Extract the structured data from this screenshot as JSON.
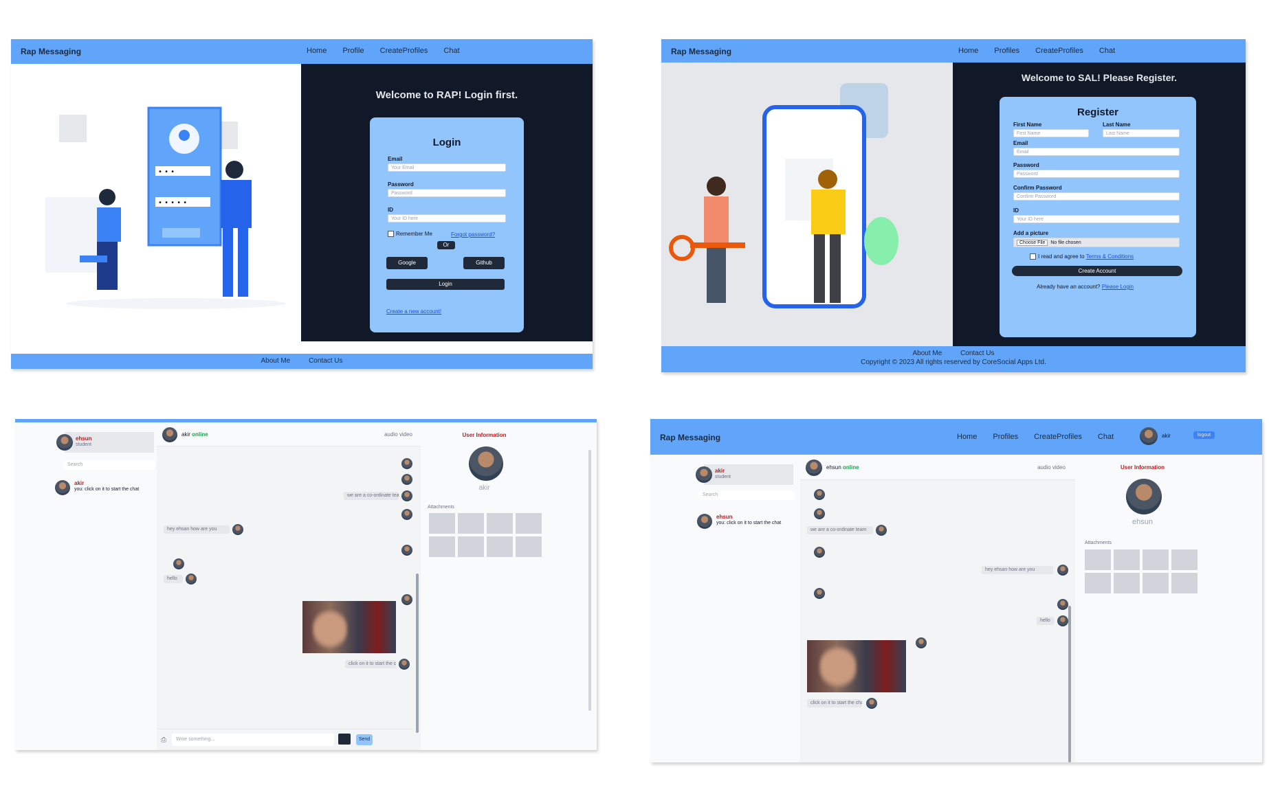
{
  "login": {
    "brand": "Rap Messaging",
    "nav": [
      "Home",
      "Profile",
      "CreateProfiles",
      "Chat"
    ],
    "welcome": "Welcome to RAP! Login first.",
    "card_title": "Login",
    "email_label": "Email",
    "email_placeholder": "Your Email",
    "password_label": "Password",
    "password_placeholder": "Password",
    "id_label": "ID",
    "id_placeholder": "Your ID here",
    "remember_label": "Remember Me",
    "forgot_link": "Forgot password?",
    "or_label": "Or",
    "google_button": "Google",
    "github_button": "Github",
    "login_button": "Login",
    "create_link": "Create a new account!",
    "footer_links": [
      "About Me",
      "Contact Us"
    ]
  },
  "register": {
    "brand": "Rap Messaging",
    "nav": [
      "Home",
      "Profiles",
      "CreateProfiles",
      "Chat"
    ],
    "welcome": "Welcome to SAL! Please Register.",
    "card_title": "Register",
    "first_name_label": "First Name",
    "first_name_placeholder": "First Name",
    "last_name_label": "Last Name",
    "last_name_placeholder": "Last Name",
    "email_label": "Email",
    "email_placeholder": "Email",
    "password_label": "Password",
    "password_placeholder": "Password",
    "confirm_label": "Confirm Password",
    "confirm_placeholder": "Confirm Password",
    "id_label": "ID",
    "id_placeholder": "Your ID here",
    "picture_label": "Add a picture",
    "choose_file": "Choose File",
    "no_file": "No file chosen",
    "terms_prefix": "I read and agree to",
    "terms_link": "Terms & Conditions",
    "create_button": "Create Account",
    "have_account": "Already have an account?",
    "login_link": "Please Login",
    "footer_links": [
      "About Me",
      "Contact Us"
    ],
    "copyright": "Copyright © 2023 All rights reserved by CoreSocial Apps Ltd."
  },
  "chat1": {
    "me_name": "ehsun",
    "me_status": "student",
    "search_placeholder": "Search",
    "contact_name": "akir",
    "contact_preview": "you: click on it to start the chat",
    "header_name": "akir",
    "header_status": "online",
    "header_actions": "audio video",
    "info_title": "User Information",
    "info_name": "akir",
    "attachments_label": "Attachments",
    "messages": [
      "we are a co-ordinate team",
      "hey ehsan how are you",
      "hello",
      "click on it to start the chat"
    ],
    "input_placeholder": "Write something...",
    "send_button": "Send"
  },
  "chat2": {
    "brand": "Rap Messaging",
    "nav": [
      "Home",
      "Profiles",
      "CreateProfiles",
      "Chat"
    ],
    "user_name": "akir",
    "logout": "logout",
    "me_name": "akir",
    "me_status": "student",
    "search_placeholder": "Search",
    "contact_name": "ehsun",
    "contact_preview": "you: click on it to start the chat",
    "header_name": "ehsun",
    "header_status": "online",
    "header_actions": "audio video",
    "info_title": "User Information",
    "info_name": "ehsun",
    "attachments_label": "Attachments",
    "messages": [
      "we are a co-ordinate team",
      "hey ehsan how are you",
      "hello",
      "click on it to start the chat"
    ]
  },
  "colors": {
    "nav": "#60a5fa",
    "dark": "#111827",
    "card": "#93c5fd",
    "link": "#1d4ed8"
  }
}
